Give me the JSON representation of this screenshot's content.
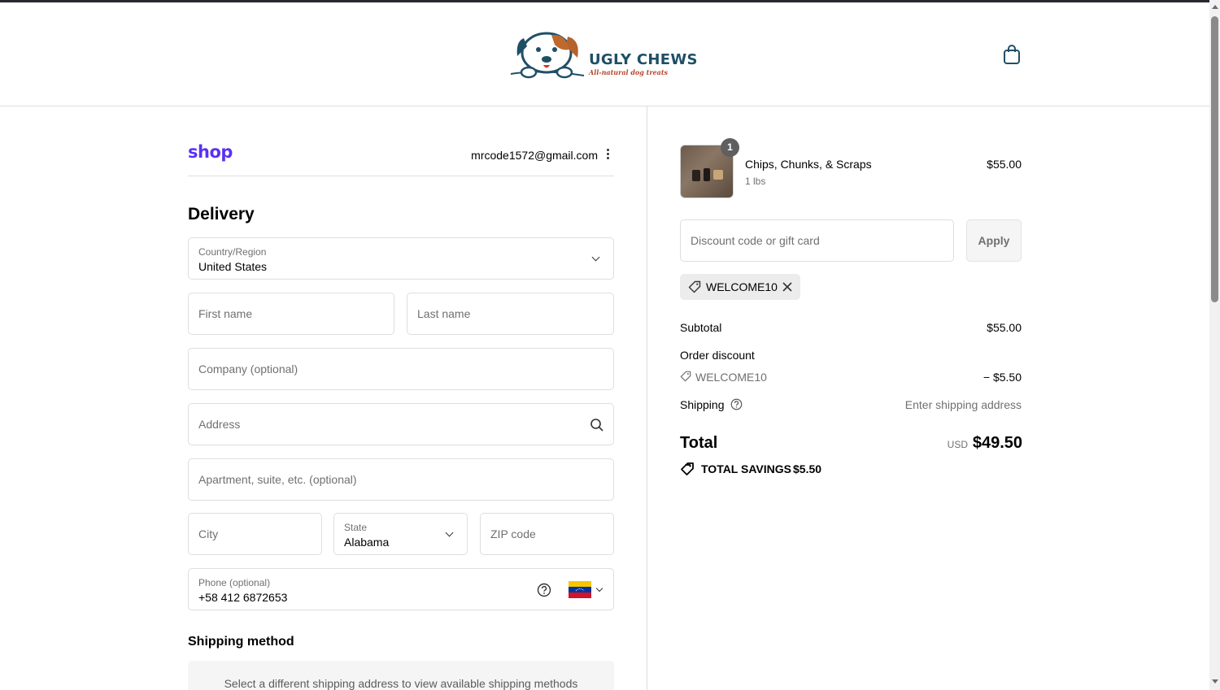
{
  "brand": {
    "name": "UGLY CHEWS",
    "tagline": "All-natural dog treats"
  },
  "header": {
    "cart_icon": "shopping-bag-icon"
  },
  "account": {
    "shop_logo": "shop",
    "email": "mrcode1572@gmail.com",
    "menu_icon": "more-vertical-icon"
  },
  "delivery": {
    "title": "Delivery",
    "country": {
      "label": "Country/Region",
      "value": "United States"
    },
    "first_name": {
      "placeholder": "First name"
    },
    "last_name": {
      "placeholder": "Last name"
    },
    "company": {
      "placeholder": "Company (optional)"
    },
    "address": {
      "placeholder": "Address",
      "icon": "search-icon"
    },
    "apartment": {
      "placeholder": "Apartment, suite, etc. (optional)"
    },
    "city": {
      "placeholder": "City"
    },
    "state": {
      "label": "State",
      "value": "Alabama"
    },
    "zip": {
      "placeholder": "ZIP code"
    },
    "phone": {
      "label": "Phone (optional)",
      "value": "+58 412 6872653",
      "help_icon": "help-circle-icon",
      "flag_icon": "venezuela-flag-icon"
    }
  },
  "shipping_method": {
    "title": "Shipping method",
    "message": "Select a different shipping address to view available shipping methods"
  },
  "order": {
    "item": {
      "quantity": "1",
      "name": "Chips, Chunks, & Scraps",
      "variant": "1 lbs",
      "price": "$55.00"
    },
    "discount_input": {
      "placeholder": "Discount code or gift card"
    },
    "apply_label": "Apply",
    "applied_code": "WELCOME10",
    "subtotal_label": "Subtotal",
    "subtotal_value": "$55.00",
    "order_discount_label": "Order discount",
    "discount_code": "WELCOME10",
    "discount_value": "− $5.50",
    "shipping_label": "Shipping",
    "shipping_value": "Enter shipping address",
    "total_label": "Total",
    "currency": "USD",
    "total_value": "$49.50",
    "savings_label": "TOTAL SAVINGS",
    "savings_value": "$5.50"
  },
  "colors": {
    "shop_brand": "#5a31f4",
    "logo_navy": "#1f4f66",
    "logo_rust": "#b5452d"
  }
}
